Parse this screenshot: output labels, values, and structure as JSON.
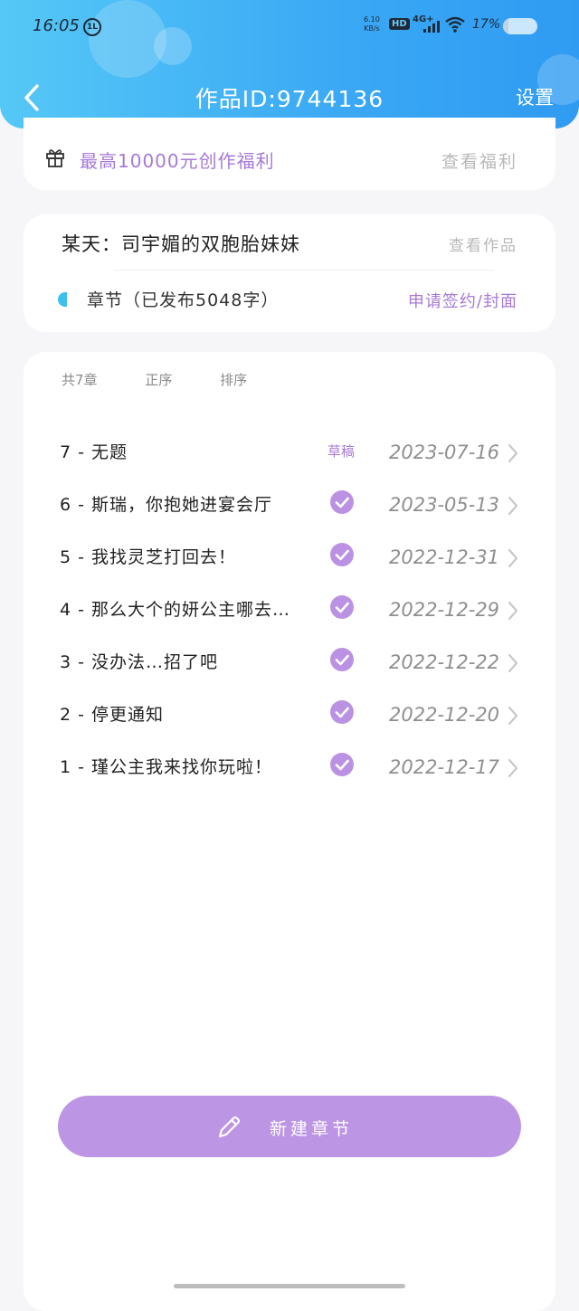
{
  "status_bar": {
    "time": "16:05",
    "notification_badge": "1L",
    "net_speed_value": "6.10",
    "net_speed_unit": "KB/s",
    "hd": "HD",
    "network": "4G+",
    "battery_percent": "17%",
    "battery_level": 0.17
  },
  "header": {
    "title": "作品ID:9744136",
    "settings_label": "设置",
    "back_icon": "chevron-left-icon"
  },
  "benefit": {
    "icon": "gift-icon",
    "text": "最高10000元创作福利",
    "link": "查看福利"
  },
  "work": {
    "title": "某天：司宇媚的双胞胎妹妹",
    "view_link": "查看作品",
    "chapter_info": "章节（已发布5048字）",
    "apply_link": "申请签约/封面"
  },
  "list": {
    "count_label": "共7章",
    "order_label": "正序",
    "sort_label": "排序",
    "chapters": [
      {
        "title": "7 - 无题",
        "status": "draft",
        "status_label": "草稿",
        "date": "2023-07-16"
      },
      {
        "title": "6 - 斯瑞，你抱她进宴会厅",
        "status": "published",
        "date": "2023-05-13"
      },
      {
        "title": "5 - 我找灵芝打回去！",
        "status": "published",
        "date": "2022-12-31"
      },
      {
        "title": "4 - 那么大个的妍公主哪去…",
        "status": "published",
        "date": "2022-12-29"
      },
      {
        "title": "3 - 没办法…招了吧",
        "status": "published",
        "date": "2022-12-22"
      },
      {
        "title": "2 - 停更通知",
        "status": "published",
        "date": "2022-12-20"
      },
      {
        "title": "1 - 瑾公主我来找你玩啦！",
        "status": "published",
        "date": "2022-12-17"
      }
    ]
  },
  "new_chapter": {
    "label": "新建章节",
    "icon": "pencil-icon"
  },
  "colors": {
    "header_gradient_start": "#55c8f6",
    "header_gradient_end": "#2f9bf2",
    "accent_purple": "#a67ad7",
    "button_purple": "#bd95e5",
    "check_purple": "#bb92e3",
    "dot_blue": "#3ec0ec"
  }
}
